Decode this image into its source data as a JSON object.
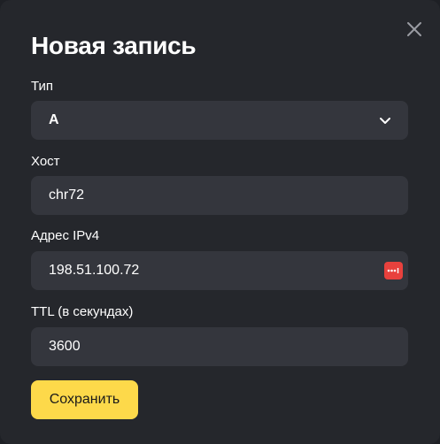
{
  "dialog": {
    "title": "Новая запись",
    "close_icon": "close-icon"
  },
  "form": {
    "type": {
      "label": "Тип",
      "value": "A",
      "icon": "chevron-down-icon"
    },
    "host": {
      "label": "Хост",
      "value": "chr72"
    },
    "ipv4": {
      "label": "Адрес IPv4",
      "value": "198.51.100.72",
      "icon": "password-manager-icon"
    },
    "ttl": {
      "label": "TTL (в секундах)",
      "value": "3600"
    }
  },
  "actions": {
    "save_label": "Сохранить"
  },
  "colors": {
    "background": "#25272c",
    "field": "#34363d",
    "accent": "#fdd94a",
    "icon_badge": "#e8413d"
  }
}
